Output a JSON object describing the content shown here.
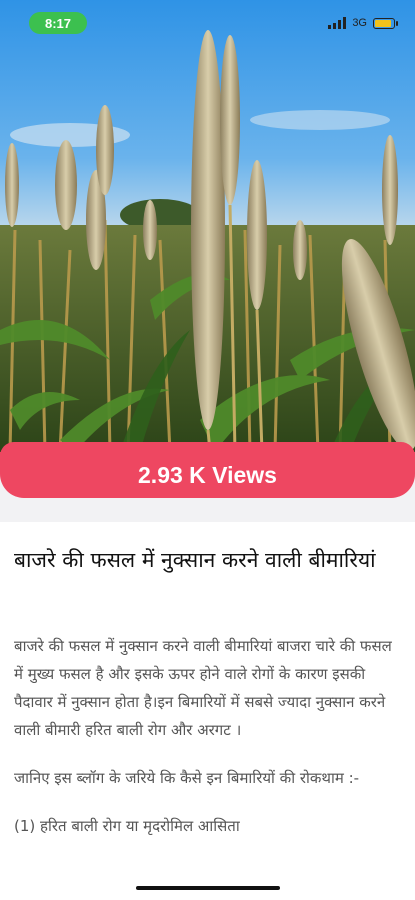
{
  "status_bar": {
    "time": "8:17",
    "network": "3G",
    "icons": [
      "signal-icon",
      "battery-icon"
    ]
  },
  "hero": {
    "image": "pearl-millet-crop-field-photo"
  },
  "views": {
    "label": "2.93 K Views"
  },
  "article": {
    "title": "बाजरे की फसल में नुक्सान करने वाली बीमारियां",
    "paragraphs": [
      "बाजरे की फसल में नुक्सान करने वाली बीमारियां बाजरा चारे की फसल में मुख्य फसल है और इसके ऊपर होने वाले रोगों के कारण इसकी पैदावार में नुक्सान होता है।इन बिमारियों में सबसे ज्यादा नुक्सान करने वाली बीमारी हरित बाली रोग और अरगट ।",
      "जानिए इस ब्लॉग के जरिये कि कैसे इन बिमारियों की रोकथाम :-",
      "(1) हरित बाली रोग या मृदरोमिल आसिता"
    ]
  },
  "colors": {
    "accent": "#ee4761",
    "time_pill": "#3cc04f",
    "battery": "#f2c21a"
  }
}
